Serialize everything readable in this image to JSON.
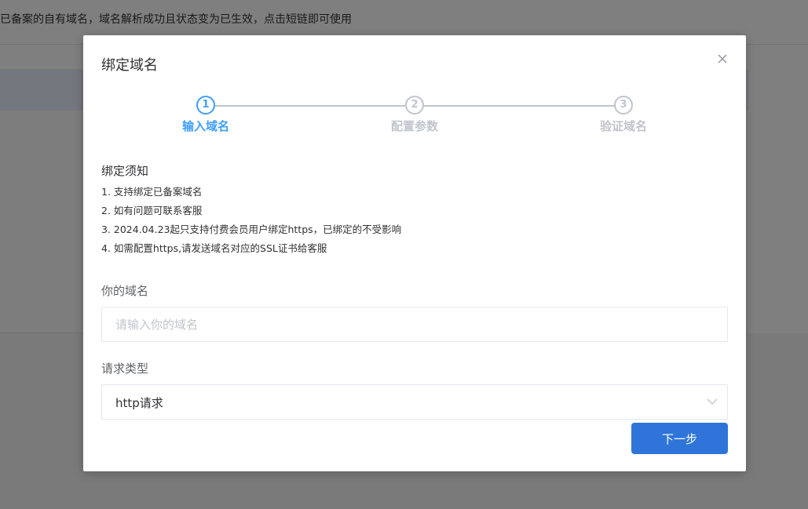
{
  "background": {
    "notice_text": "已备案的自有域名，域名解析成功且状态变为已生效，点击短链即可使用"
  },
  "dialog": {
    "title": "绑定域名",
    "close_icon": "close-icon"
  },
  "steps": [
    {
      "number": "1",
      "label": "输入域名",
      "active": true
    },
    {
      "number": "2",
      "label": "配置参数",
      "active": false
    },
    {
      "number": "3",
      "label": "验证域名",
      "active": false
    }
  ],
  "notice": {
    "title": "绑定须知",
    "items": [
      "1. 支持绑定已备案域名",
      "2. 如有问题可联系客服",
      "3. 2024.04.23起只支持付费会员用户绑定https，已绑定的不受影响",
      "4. 如需配置https,请发送域名对应的SSL证书给客服"
    ]
  },
  "form": {
    "domain_label": "你的域名",
    "domain_value": "",
    "domain_placeholder": "请输入你的域名",
    "request_type_label": "请求类型",
    "request_type_value": "http请求"
  },
  "actions": {
    "next_label": "下一步"
  },
  "colors": {
    "accent": "#409eff",
    "button": "#2f75d9",
    "inactive": "#c0c4cc"
  }
}
